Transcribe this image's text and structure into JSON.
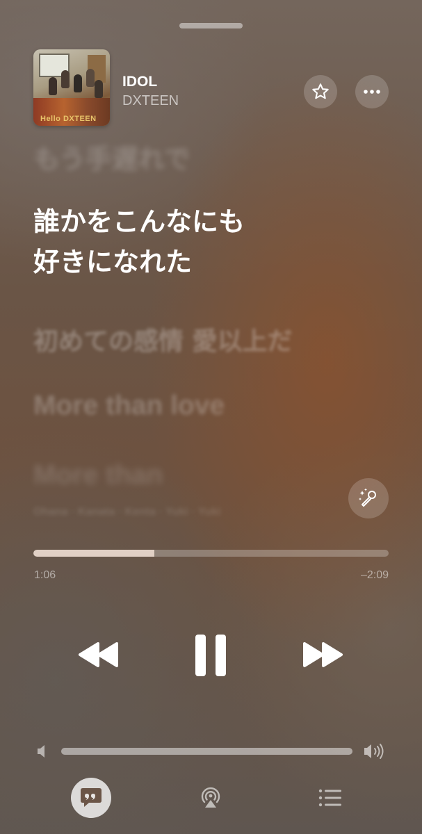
{
  "now_playing": {
    "title": "IDOL",
    "artist": "DXTEEN",
    "artwork_text": "Hello DXTEEN"
  },
  "lyrics": {
    "previous": "もう手遅れで",
    "current_line1": "誰かをこんなにも",
    "current_line2": "好きになれた",
    "next1": "初めての感情 愛以上だ",
    "next2": "More than love",
    "next3": "More than",
    "credits": "Ohana · Kanata · Kenta · Yuki · Yuki"
  },
  "playback": {
    "elapsed": "1:06",
    "remaining": "–2:09",
    "progress": 0.34,
    "state": "playing"
  },
  "volume": {
    "level": 1.0
  },
  "icons": {
    "favorite": "star-icon",
    "more": "ellipsis-icon",
    "sing": "microphone-sparkle-icon",
    "rewind": "rewind-icon",
    "pause": "pause-icon",
    "forward": "fast-forward-icon",
    "volume_low": "speaker-low-icon",
    "volume_high": "speaker-high-icon",
    "lyrics": "lyrics-quote-icon",
    "airplay": "airplay-icon",
    "queue": "queue-list-icon"
  },
  "colors": {
    "background": "#6e5645",
    "progress_fill": "#f0ded2",
    "text_primary": "#ffffff"
  }
}
